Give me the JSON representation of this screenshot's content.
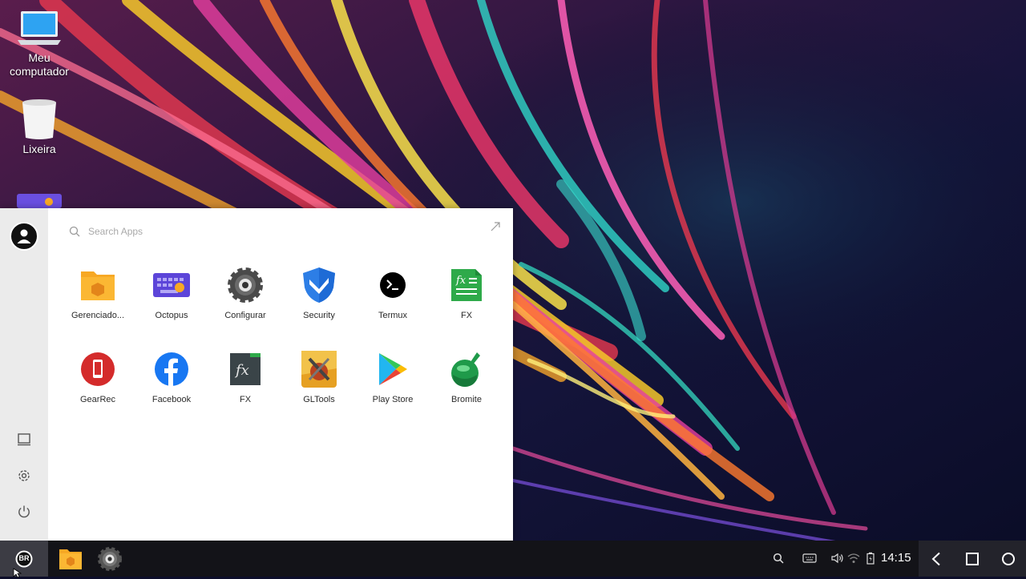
{
  "desktop": {
    "icons": [
      {
        "label": "Meu computador",
        "icon": "laptop-icon"
      },
      {
        "label": "Lixeira",
        "icon": "trash-bin-icon"
      },
      {
        "label": "",
        "icon": "octopus-keyboard-icon"
      }
    ]
  },
  "start_menu": {
    "search_placeholder": "Search Apps",
    "apps": [
      {
        "label": "Gerenciado...",
        "icon": "file-manager-icon"
      },
      {
        "label": "Octopus",
        "icon": "octopus-keyboard-icon"
      },
      {
        "label": "Configurar",
        "icon": "gear-icon"
      },
      {
        "label": "Security",
        "icon": "shield-icon"
      },
      {
        "label": "Termux",
        "icon": "terminal-icon"
      },
      {
        "label": "FX",
        "icon": "fx-green-icon"
      },
      {
        "label": "GearRec",
        "icon": "gearrec-icon"
      },
      {
        "label": "Facebook",
        "icon": "facebook-icon"
      },
      {
        "label": "FX",
        "icon": "fx-dark-icon"
      },
      {
        "label": "GLTools",
        "icon": "gltools-icon"
      },
      {
        "label": "Play Store",
        "icon": "play-store-icon"
      },
      {
        "label": "Bromite",
        "icon": "bromite-icon"
      }
    ],
    "side_buttons": [
      "desktop-mode-icon",
      "settings-icon",
      "power-icon"
    ]
  },
  "taskbar": {
    "start_logo_text": "BR",
    "pinned_apps": [
      "file-manager-icon",
      "gear-icon"
    ],
    "tray": [
      "search-icon",
      "keyboard-icon",
      "volume-icon",
      "wifi-icon",
      "battery-icon"
    ],
    "time": "14:15",
    "nav_buttons": [
      "back-icon",
      "recents-icon",
      "home-icon"
    ]
  },
  "colors": {
    "start_menu_bg": "#ffffff",
    "sidebar_bg": "#ebebeb",
    "taskbar_bg": "#131318",
    "accent_orange": "#f7a824"
  }
}
